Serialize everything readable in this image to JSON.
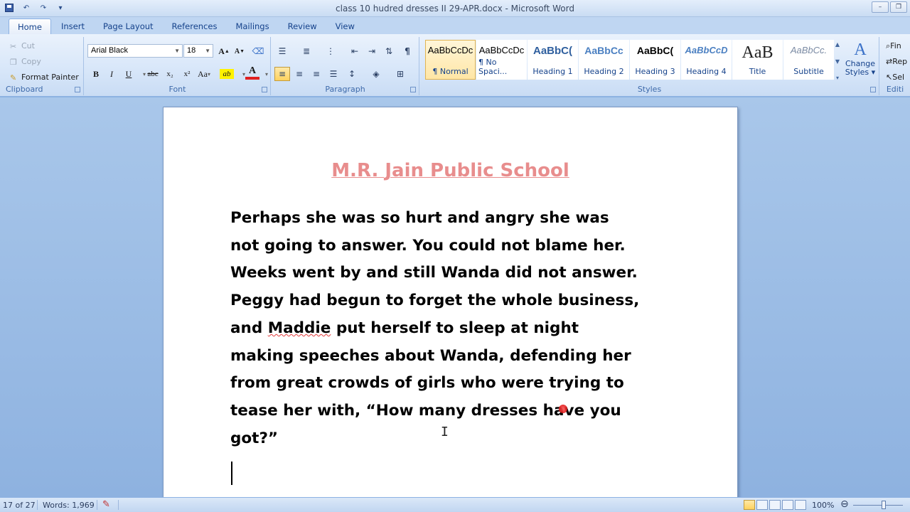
{
  "window": {
    "title": "class 10 hudred dresses II 29-APR.docx - Microsoft Word"
  },
  "tabs": [
    "Home",
    "Insert",
    "Page Layout",
    "References",
    "Mailings",
    "Review",
    "View"
  ],
  "clipboard": {
    "cut": "Cut",
    "copy": "Copy",
    "format_painter": "Format Painter",
    "label": "Clipboard"
  },
  "font": {
    "name": "Arial Black",
    "size": "18",
    "change_case": "Aa",
    "label": "Font",
    "buttons": {
      "grow": "A",
      "shrink": "A",
      "bold": "B",
      "italic": "I",
      "underline": "U",
      "strike": "abc",
      "subscript": "x₂",
      "superscript": "x²",
      "highlight": "ab",
      "font_color": "A"
    }
  },
  "paragraph": {
    "label": "Paragraph",
    "pilcrow": "¶"
  },
  "styles": {
    "label": "Styles",
    "items": [
      {
        "sample": "AaBbCcDc",
        "name": "¶ Normal"
      },
      {
        "sample": "AaBbCcDc",
        "name": "¶ No Spaci..."
      },
      {
        "sample": "AaBbC(",
        "name": "Heading 1"
      },
      {
        "sample": "AaBbCc",
        "name": "Heading 2"
      },
      {
        "sample": "AaBbC(",
        "name": "Heading 3"
      },
      {
        "sample": "AaBbCcD",
        "name": "Heading 4"
      },
      {
        "sample": "AaB",
        "name": "Title"
      },
      {
        "sample": "AaBbCc.",
        "name": "Subtitle"
      }
    ],
    "change_styles_line1": "Change",
    "change_styles_line2": "Styles ▾"
  },
  "editing": {
    "find": "Fin",
    "replace": "Rep",
    "select": "Sel",
    "label": "Editi"
  },
  "document": {
    "heading": "M.R. Jain Public School",
    "lines": [
      "Perhaps she was so hurt and angry she was",
      "not going to answer. You could not blame her.",
      "Weeks went by and still Wanda did not answer.",
      "Peggy had begun to forget the whole business,",
      "and ",
      "Maddie",
      " put herself to sleep at night",
      "making speeches about Wanda, defending her",
      "from great crowds of girls who were trying to",
      "tease her with, “How many dresses have you",
      "got?”"
    ]
  },
  "status": {
    "page": "17 of 27",
    "words": "Words: 1,969",
    "zoom": "100%"
  },
  "colors": {
    "heading": "#e88d8d",
    "ribbon": "#d7e6f9",
    "doc_background": "#8eb2e0"
  }
}
